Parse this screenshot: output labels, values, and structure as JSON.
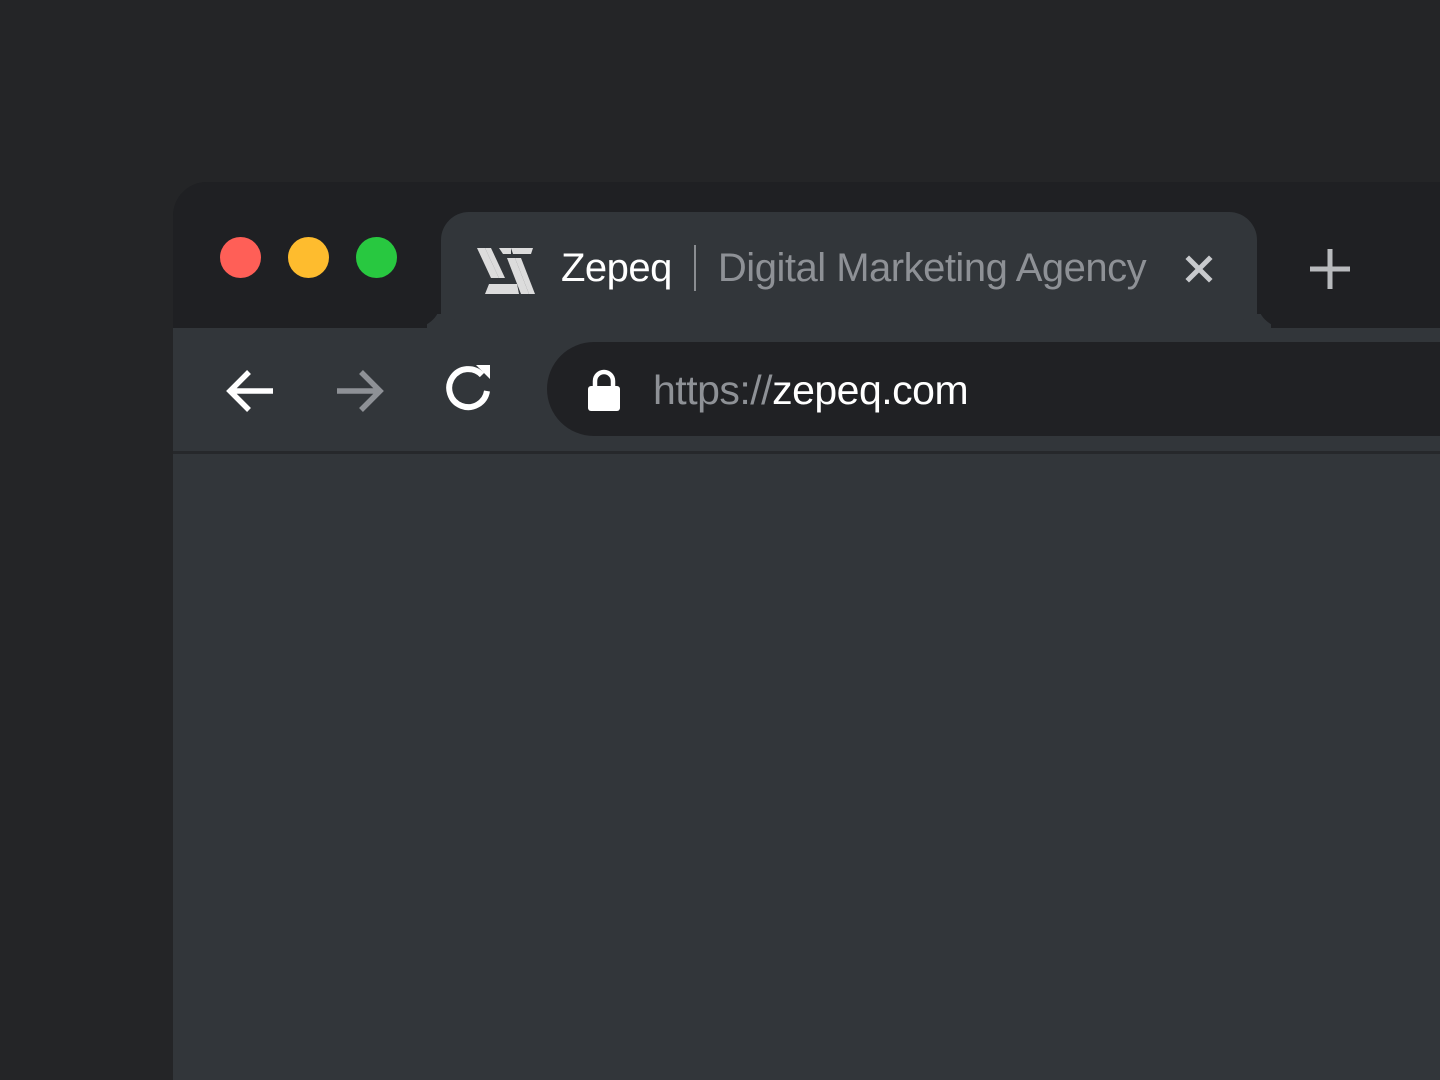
{
  "window": {
    "traffic_lights": [
      {
        "name": "close",
        "color": "#ff5f57"
      },
      {
        "name": "minimize",
        "color": "#febc2e"
      },
      {
        "name": "zoom",
        "color": "#28c840"
      }
    ]
  },
  "tab": {
    "favicon": "zepeq-logo-icon",
    "brand": "Zepeq",
    "subtitle": "Digital Marketing Agency",
    "close_icon": "close-icon"
  },
  "new_tab_icon": "plus-icon",
  "toolbar": {
    "back_icon": "arrow-left-icon",
    "forward_icon": "arrow-right-icon",
    "reload_icon": "reload-icon",
    "forward_enabled": false
  },
  "address_bar": {
    "lock_icon": "lock-icon",
    "scheme": "https://",
    "host": "zepeq.com"
  },
  "colors": {
    "page_background": "#242527",
    "tab_strip": "#1f2023",
    "active_tab": "#32363a",
    "omnibox": "#202124",
    "text_primary": "#ffffff",
    "text_secondary": "#8e9196"
  }
}
